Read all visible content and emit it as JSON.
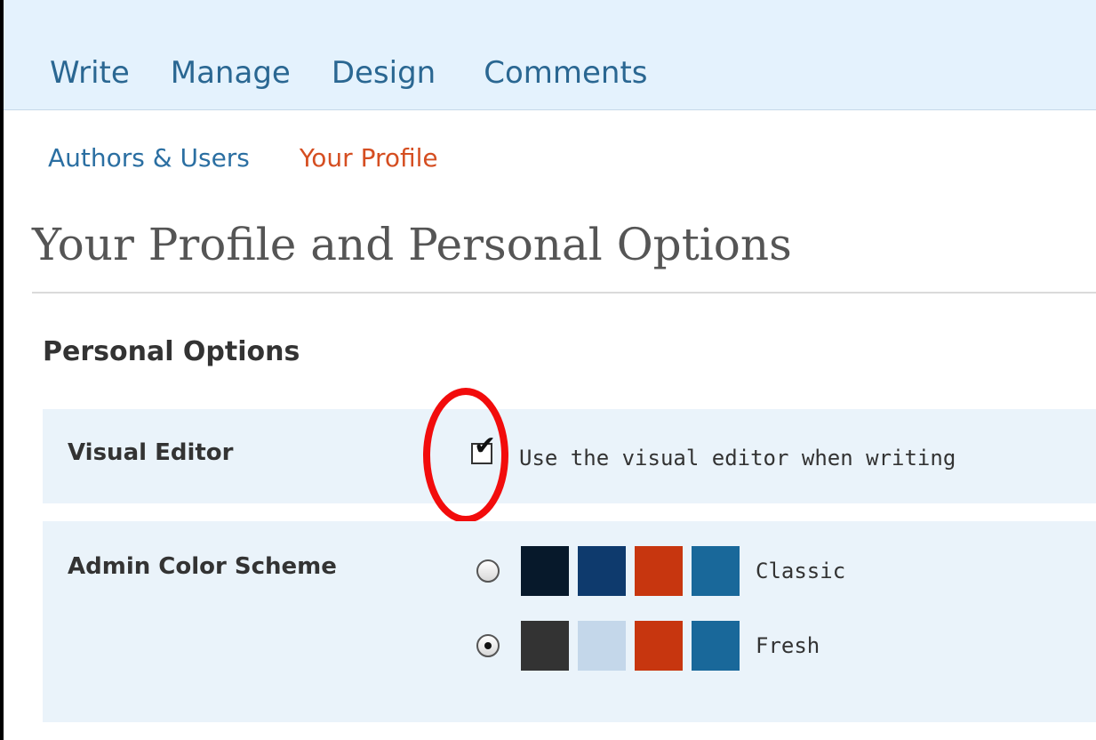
{
  "top_nav": {
    "items": [
      "Write",
      "Manage",
      "Design",
      "Comments"
    ]
  },
  "sub_nav": {
    "items": [
      "Authors & Users",
      "Your Profile"
    ],
    "current": "Your Profile"
  },
  "page_title": "Your Profile and Personal Options",
  "section_heading": "Personal Options",
  "visual_editor": {
    "label": "Visual Editor",
    "checkbox_label": "Use the visual editor when writing",
    "checked": true
  },
  "color_scheme": {
    "label": "Admin Color Scheme",
    "schemes": [
      {
        "name": "Classic",
        "selected": false,
        "swatches": [
          "#07192b",
          "#0e3a6d",
          "#c7360f",
          "#19689a"
        ]
      },
      {
        "name": "Fresh",
        "selected": true,
        "swatches": [
          "#333333",
          "#c4d7ea",
          "#c7360f",
          "#19689a"
        ]
      }
    ]
  },
  "colors": {
    "nav_background": "#e4f2fd",
    "nav_link": "#2a6792",
    "current_link": "#d54e21",
    "row_background": "#eaf3fa",
    "highlight": "#f20c0c"
  }
}
